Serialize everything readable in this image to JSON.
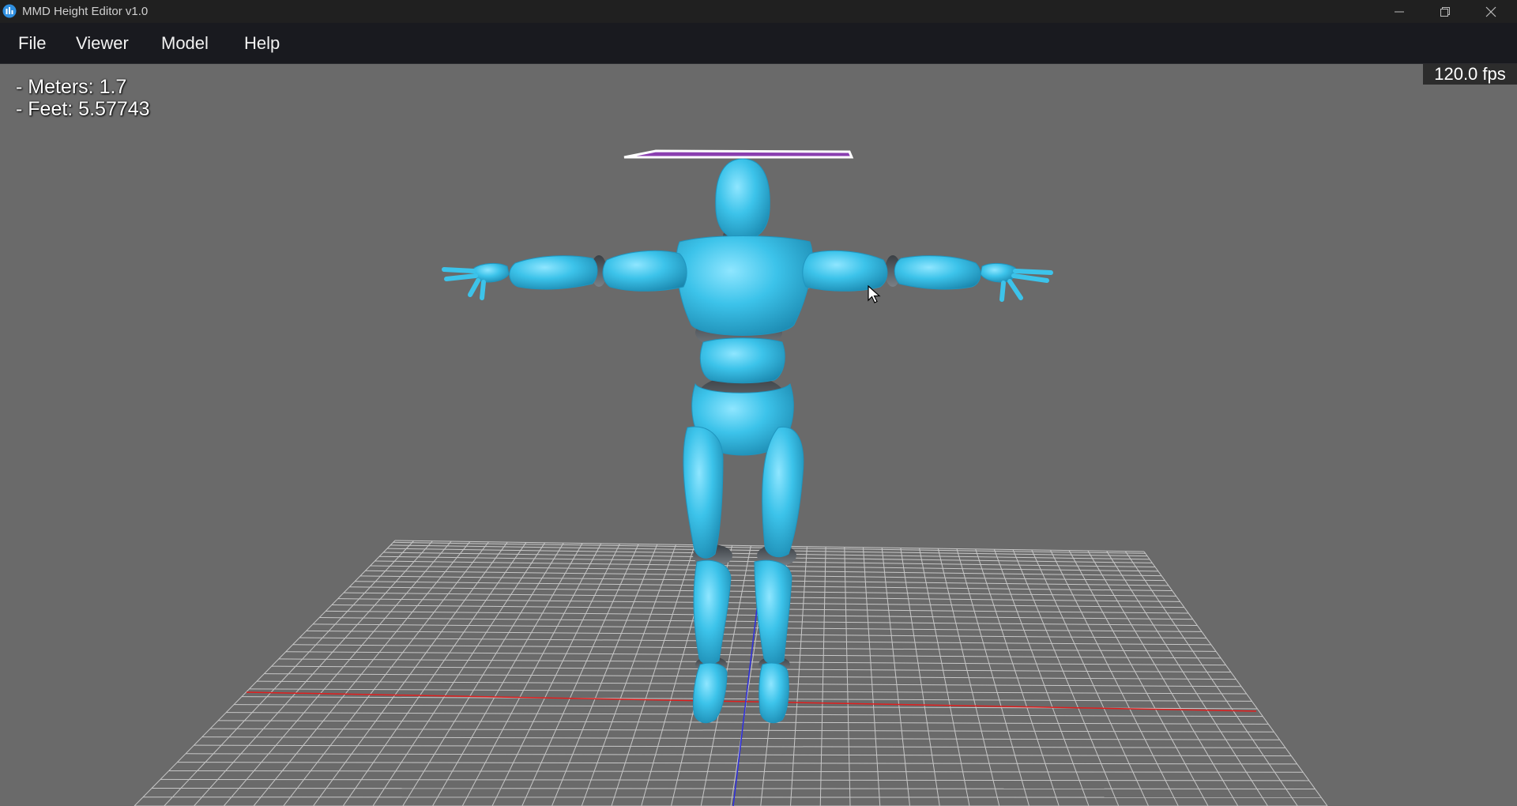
{
  "window": {
    "title": "MMD Height Editor v1.0",
    "icon": "app-logo-icon",
    "controls": [
      "minimize-icon",
      "restore-icon",
      "close-icon"
    ]
  },
  "menu": {
    "items": [
      {
        "label": "File"
      },
      {
        "label": "Viewer"
      },
      {
        "label": "Model"
      },
      {
        "label": "Help"
      }
    ]
  },
  "viewport": {
    "meters_text": "- Meters: 1.7",
    "feet_text": "- Feet: 5.57743",
    "fps_text": "120.0 fps"
  },
  "scene": {
    "background_color": "#6a6a6a",
    "model_color": "#3cc3ea",
    "joint_color": "#4e5a60",
    "grid_color": "#d8d8d8",
    "x_axis_color": "#e01e1e",
    "z_axis_color": "#2e2ee0",
    "height_marker_color": "#8a3fb0",
    "objects": [
      "floor-grid",
      "mannequin-model",
      "height-marker-plane",
      "x-axis-line",
      "z-axis-line"
    ]
  }
}
